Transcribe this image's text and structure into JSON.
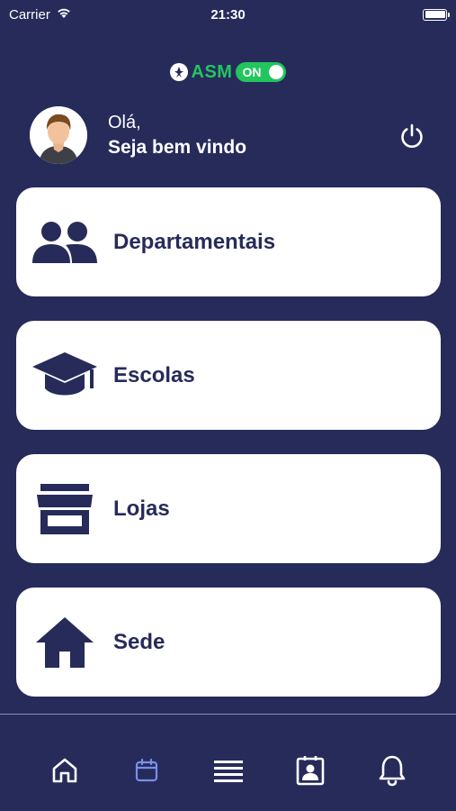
{
  "status_bar": {
    "carrier": "Carrier",
    "time": "21:30",
    "battery_level": 1.0
  },
  "brand": {
    "name": "ASM",
    "toggle_label": "ON",
    "accent_color": "#22c55e"
  },
  "greeting": {
    "hello": "Olá,",
    "welcome": "Seja bem vindo"
  },
  "menu": {
    "items": [
      {
        "label": "Departamentais",
        "icon": "users-icon"
      },
      {
        "label": "Escolas",
        "icon": "graduation-cap-icon"
      },
      {
        "label": "Lojas",
        "icon": "store-icon"
      },
      {
        "label": "Sede",
        "icon": "home-icon"
      }
    ]
  },
  "tabbar": {
    "tabs": [
      {
        "icon": "home-outline-icon",
        "active": false
      },
      {
        "icon": "calendar-icon",
        "active": true
      },
      {
        "icon": "list-icon",
        "active": false
      },
      {
        "icon": "contact-card-icon",
        "active": false
      },
      {
        "icon": "bell-icon",
        "active": false
      }
    ],
    "active_color": "#7b8fe8",
    "inactive_color": "#ffffff"
  },
  "colors": {
    "background": "#262b5a",
    "card": "#ffffff",
    "card_text": "#262b5a"
  }
}
